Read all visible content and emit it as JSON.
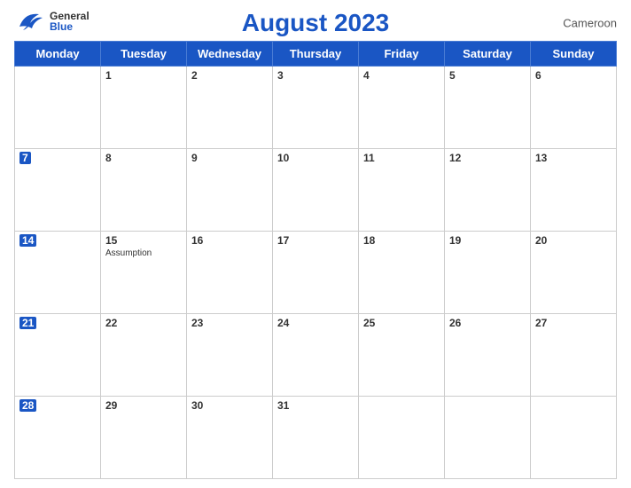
{
  "header": {
    "title": "August 2023",
    "country": "Cameroon",
    "logo_general": "General",
    "logo_blue": "Blue"
  },
  "weekdays": [
    "Monday",
    "Tuesday",
    "Wednesday",
    "Thursday",
    "Friday",
    "Saturday",
    "Sunday"
  ],
  "weeks": [
    [
      {
        "date": "",
        "holiday": ""
      },
      {
        "date": "1",
        "holiday": ""
      },
      {
        "date": "2",
        "holiday": ""
      },
      {
        "date": "3",
        "holiday": ""
      },
      {
        "date": "4",
        "holiday": ""
      },
      {
        "date": "5",
        "holiday": ""
      },
      {
        "date": "6",
        "holiday": ""
      }
    ],
    [
      {
        "date": "7",
        "holiday": ""
      },
      {
        "date": "8",
        "holiday": ""
      },
      {
        "date": "9",
        "holiday": ""
      },
      {
        "date": "10",
        "holiday": ""
      },
      {
        "date": "11",
        "holiday": ""
      },
      {
        "date": "12",
        "holiday": ""
      },
      {
        "date": "13",
        "holiday": ""
      }
    ],
    [
      {
        "date": "14",
        "holiday": ""
      },
      {
        "date": "15",
        "holiday": "Assumption"
      },
      {
        "date": "16",
        "holiday": ""
      },
      {
        "date": "17",
        "holiday": ""
      },
      {
        "date": "18",
        "holiday": ""
      },
      {
        "date": "19",
        "holiday": ""
      },
      {
        "date": "20",
        "holiday": ""
      }
    ],
    [
      {
        "date": "21",
        "holiday": ""
      },
      {
        "date": "22",
        "holiday": ""
      },
      {
        "date": "23",
        "holiday": ""
      },
      {
        "date": "24",
        "holiday": ""
      },
      {
        "date": "25",
        "holiday": ""
      },
      {
        "date": "26",
        "holiday": ""
      },
      {
        "date": "27",
        "holiday": ""
      }
    ],
    [
      {
        "date": "28",
        "holiday": ""
      },
      {
        "date": "29",
        "holiday": ""
      },
      {
        "date": "30",
        "holiday": ""
      },
      {
        "date": "31",
        "holiday": ""
      },
      {
        "date": "",
        "holiday": ""
      },
      {
        "date": "",
        "holiday": ""
      },
      {
        "date": "",
        "holiday": ""
      }
    ]
  ]
}
